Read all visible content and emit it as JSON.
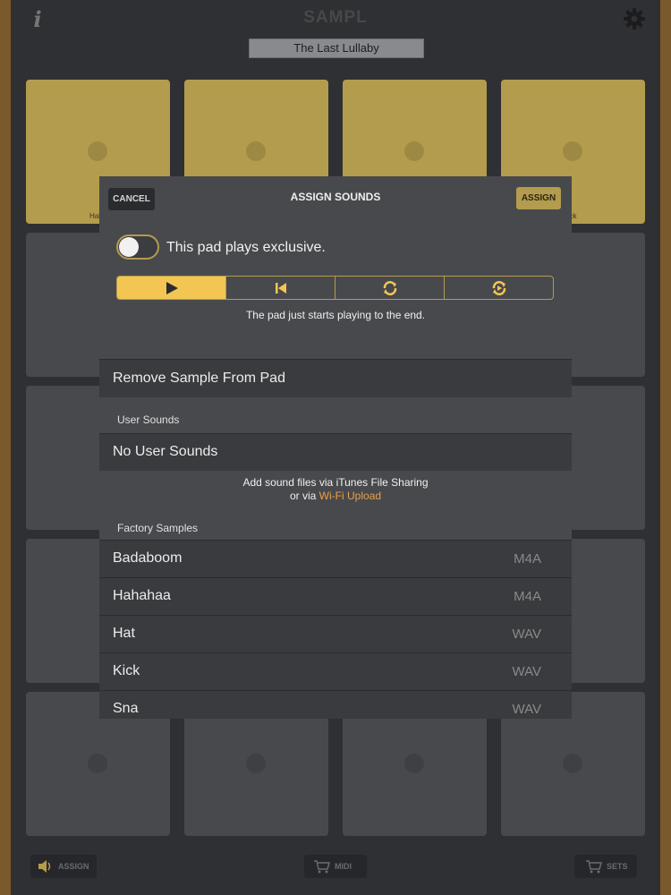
{
  "app": {
    "title": "SAMPL",
    "set_name": "The Last Lullaby",
    "info_icon_glyph": "i"
  },
  "pads": {
    "top_row_labels": [
      "Haha",
      "",
      "",
      "ck"
    ]
  },
  "bottom_bar": {
    "assign_label": "ASSIGN",
    "midi_label": "MIDI",
    "sets_label": "SETS"
  },
  "modal": {
    "cancel_label": "CANCEL",
    "title": "ASSIGN SOUNDS",
    "assign_label": "ASSIGN",
    "exclusive_label": "This pad plays exclusive.",
    "exclusive_on": false,
    "play_modes": [
      "play-icon",
      "skip-back-icon",
      "loop-icon",
      "loop-refresh-icon"
    ],
    "active_mode": 0,
    "mode_description": "The pad just starts playing to the end.",
    "remove_label": "Remove Sample From Pad",
    "user_sounds_header": "User Sounds",
    "no_user_sounds": "No User Sounds",
    "hint_line1": "Add sound files via iTunes File Sharing",
    "hint_prefix": "or via ",
    "hint_link": "Wi-Fi Upload",
    "factory_header": "Factory Samples",
    "factory_samples": [
      {
        "name": "Badaboom",
        "type": "M4A"
      },
      {
        "name": "Hahahaa",
        "type": "M4A"
      },
      {
        "name": "Hat",
        "type": "WAV"
      },
      {
        "name": "Kick",
        "type": "WAV"
      },
      {
        "name": "Sna",
        "type": "WAV"
      }
    ]
  },
  "colors": {
    "gold": "#b39c4d",
    "active_segment": "#f3c654",
    "link": "#e9a04a"
  }
}
